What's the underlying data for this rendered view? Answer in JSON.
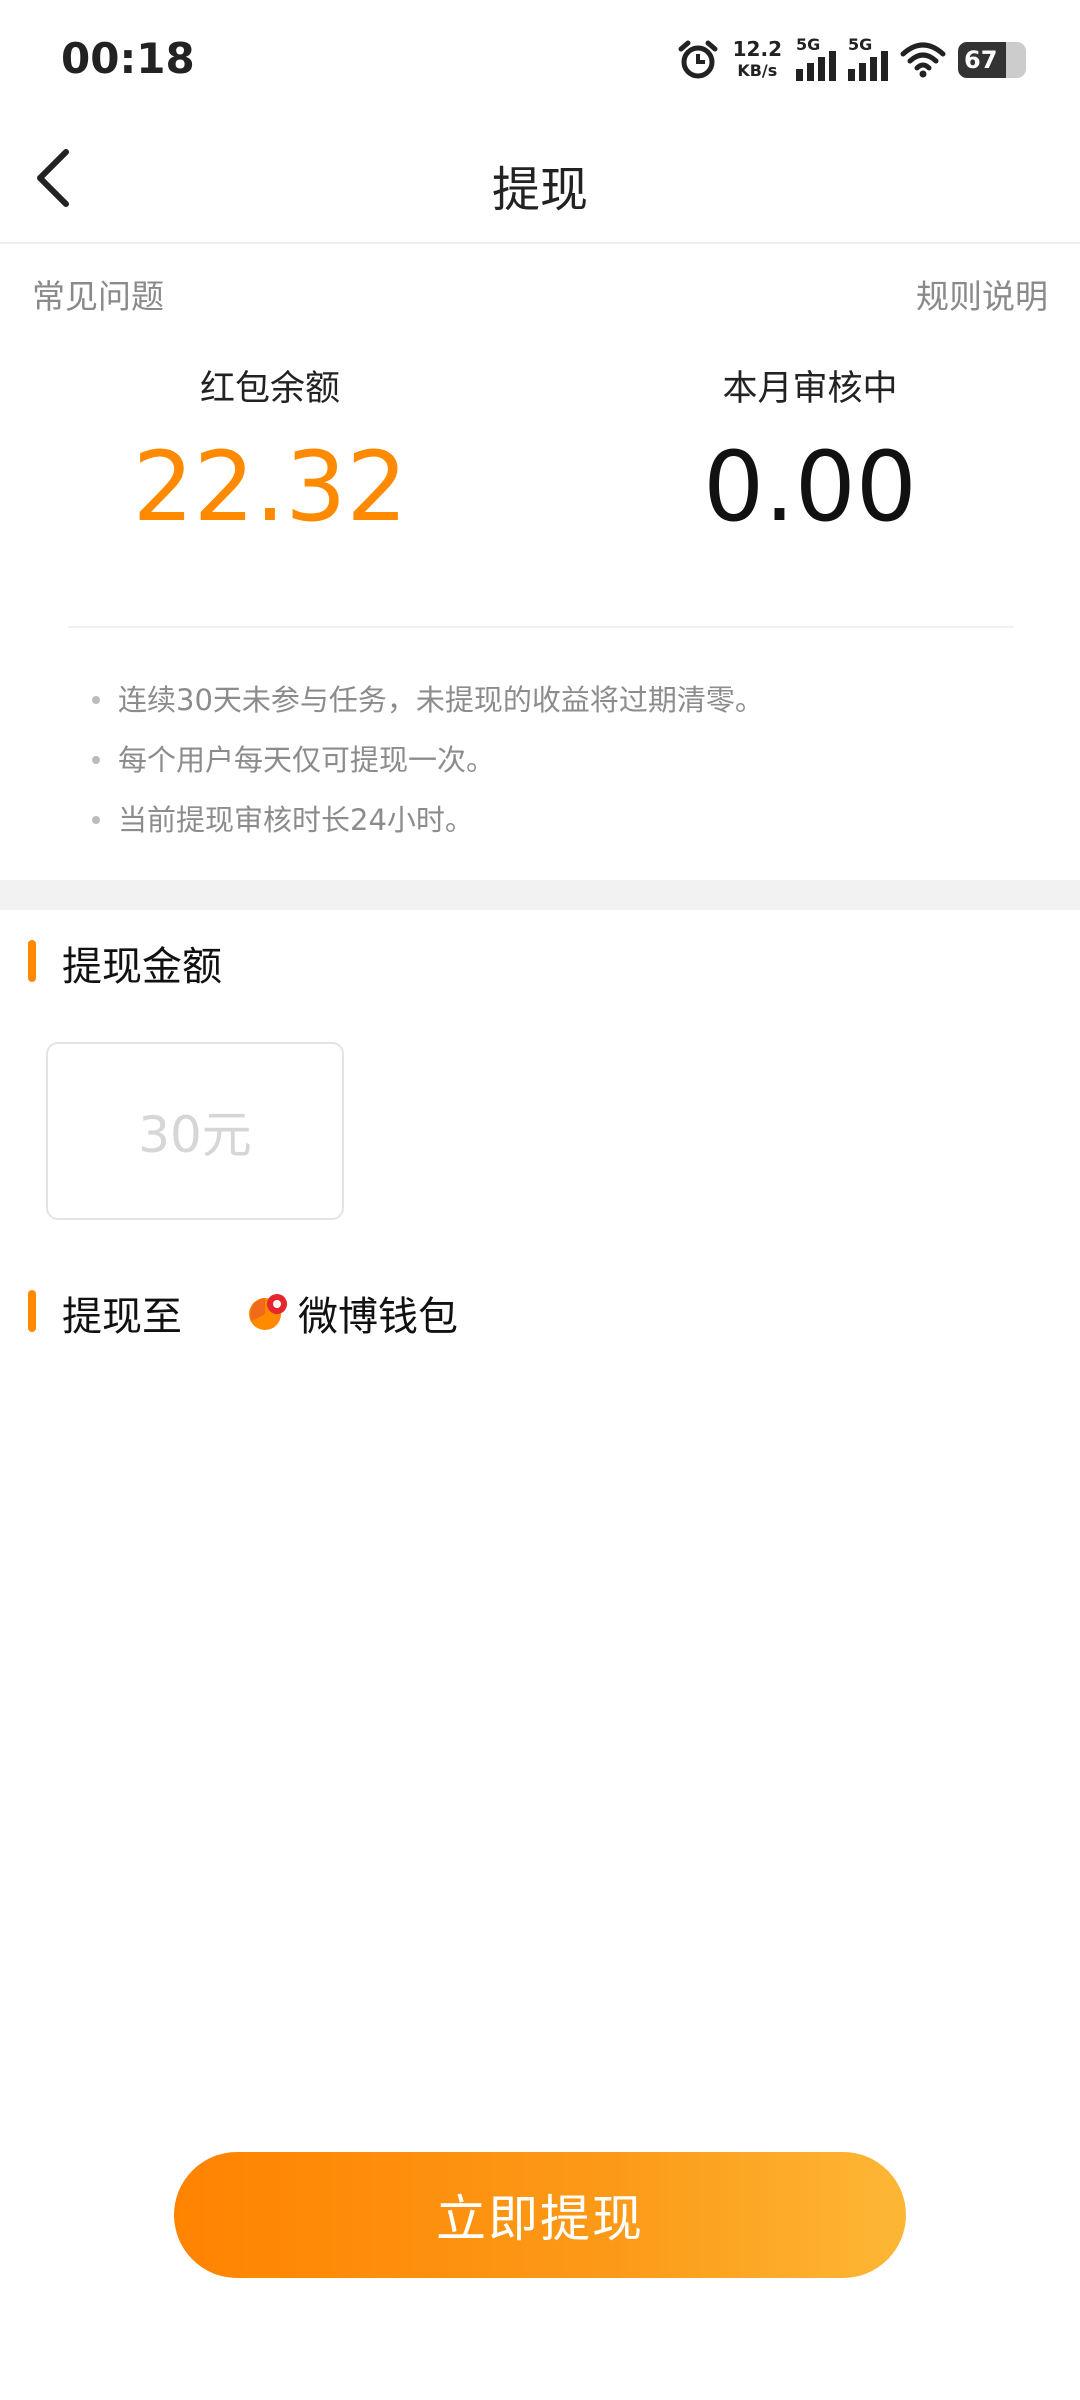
{
  "status_bar": {
    "time": "00:18",
    "net_speed_value": "12.2",
    "net_speed_unit": "KB/s",
    "sim1_label": "5G",
    "sim2_label": "5G",
    "battery": "67"
  },
  "header": {
    "title": "提现"
  },
  "links": {
    "faq": "常见问题",
    "rules": "规则说明"
  },
  "stats": {
    "balance_label": "红包余额",
    "balance_value": "22.32",
    "pending_label": "本月审核中",
    "pending_value": "0.00"
  },
  "notes": [
    "连续30天未参与任务，未提现的收益将过期清零。",
    "每个用户每天仅可提现一次。",
    "当前提现审核时长24小时。"
  ],
  "amount_section": {
    "title": "提现金额",
    "options": [
      "30元"
    ]
  },
  "destination_section": {
    "title": "提现至",
    "wallet_name": "微博钱包"
  },
  "cta": {
    "label": "立即提现"
  },
  "colors": {
    "accent": "#ff8a00",
    "gradient_end": "#fdb735"
  }
}
